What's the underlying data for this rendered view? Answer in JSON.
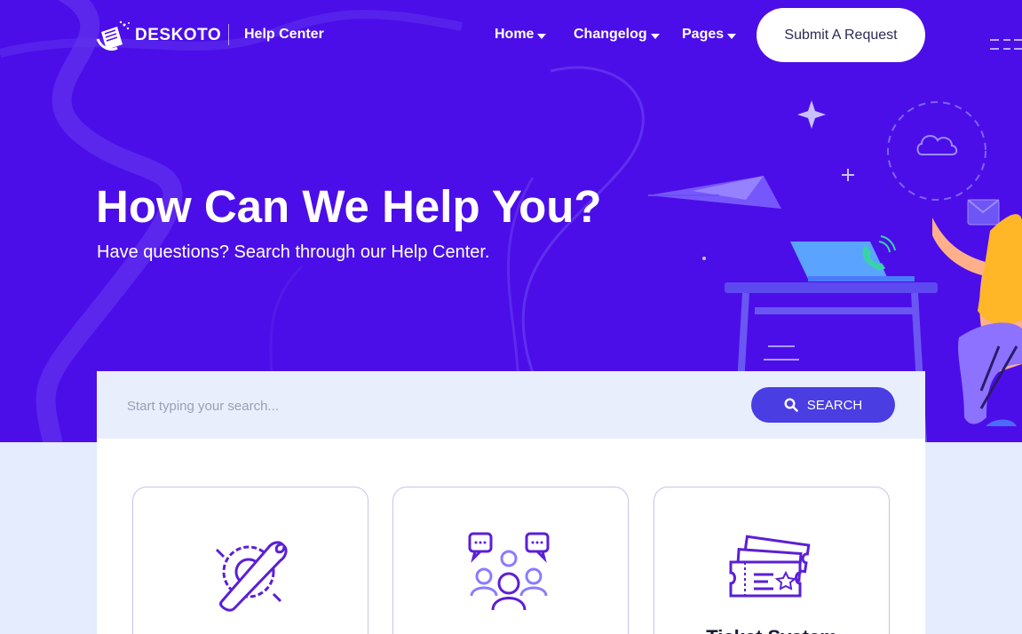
{
  "brand": {
    "name": "DESKOTO",
    "section": "Help Center"
  },
  "nav": {
    "menus": [
      {
        "label": "Home"
      },
      {
        "label": "Changelog"
      },
      {
        "label": "Pages"
      }
    ],
    "cta": "Submit A Request"
  },
  "hero": {
    "title": "How Can We Help You?",
    "subtitle": "Have questions? Search through our Help Center."
  },
  "search": {
    "placeholder": "Start typing your search...",
    "button_label": "SEARCH"
  },
  "categories": [
    {
      "icon": "gear-wrench-icon",
      "title": ""
    },
    {
      "icon": "community-chat-icon",
      "title": ""
    },
    {
      "icon": "ticket-icon",
      "title": "Ticket System"
    }
  ],
  "colors": {
    "hero_bg": "#4b0ee8",
    "accent": "#4a3de2",
    "page_bg": "#e4ecfd"
  }
}
